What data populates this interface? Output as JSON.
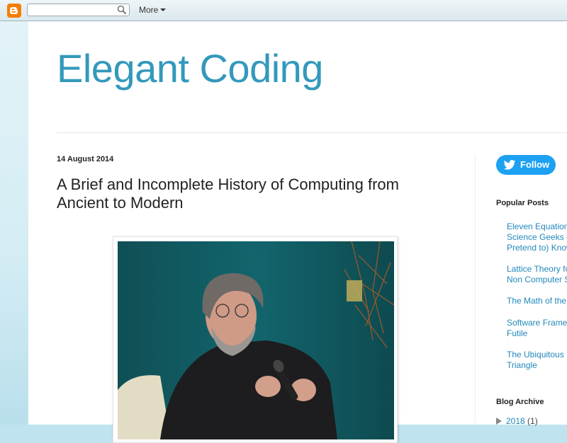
{
  "navbar": {
    "search_placeholder": "",
    "more_label": "More"
  },
  "blog": {
    "title": "Elegant Coding"
  },
  "post": {
    "date": "14 August 2014",
    "title": "A Brief and Incomplete History of Computing from Ancient to Modern"
  },
  "sidebar": {
    "follow_label": "Follow",
    "popular_heading": "Popular Posts",
    "popular_posts": [
      {
        "line1": "Eleven Equations",
        "line2": "Science Geeks (",
        "line3": "Pretend to) Know"
      },
      {
        "line1": "Lattice Theory fo",
        "line2": "Non Computer S"
      },
      {
        "line1": "The Math of the"
      },
      {
        "line1": "Software Frame",
        "line2": "Futile"
      },
      {
        "line1": "The Ubiquitous",
        "line2": "Triangle"
      }
    ],
    "archive_heading": "Blog Archive",
    "archive_year": "2018",
    "archive_count": "(1)"
  },
  "colors": {
    "title": "#3399bb",
    "link": "#2288bb",
    "twitter": "#1da1f2",
    "blogger": "#f57d00"
  }
}
